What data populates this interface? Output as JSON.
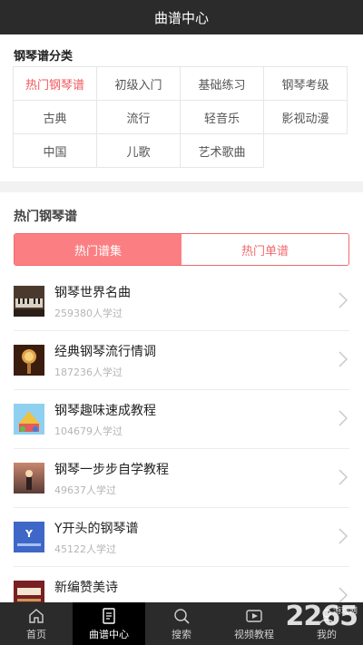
{
  "header": {
    "title": "曲谱中心"
  },
  "categories": {
    "title": "钢琴谱分类",
    "items": [
      {
        "label": "热门钢琴谱",
        "active": true
      },
      {
        "label": "初级入门"
      },
      {
        "label": "基础练习"
      },
      {
        "label": "钢琴考级"
      },
      {
        "label": "古典"
      },
      {
        "label": "流行"
      },
      {
        "label": "轻音乐"
      },
      {
        "label": "影视动漫"
      },
      {
        "label": "中国"
      },
      {
        "label": "儿歌"
      },
      {
        "label": "艺术歌曲"
      }
    ]
  },
  "hot": {
    "title": "热门钢琴谱",
    "tabs": [
      {
        "label": "热门谱集",
        "active": true
      },
      {
        "label": "热门单谱"
      }
    ],
    "items": [
      {
        "title": "钢琴世界名曲",
        "sub": "259380人学过"
      },
      {
        "title": "经典钢琴流行情调",
        "sub": "187236人学过"
      },
      {
        "title": "钢琴趣味速成教程",
        "sub": "104679人学过"
      },
      {
        "title": "钢琴一步步自学教程",
        "sub": "49637人学过"
      },
      {
        "title": "Y开头的钢琴谱",
        "sub": "45122人学过"
      },
      {
        "title": "新编赞美诗",
        "sub": ""
      }
    ]
  },
  "tabbar": {
    "items": [
      {
        "label": "首页",
        "icon": "home-icon"
      },
      {
        "label": "曲谱中心",
        "icon": "score-icon",
        "active": true
      },
      {
        "label": "搜索",
        "icon": "search-icon"
      },
      {
        "label": "视频教程",
        "icon": "video-icon"
      },
      {
        "label": "我的",
        "icon": "user-icon"
      }
    ]
  },
  "watermark": {
    "text": "2265",
    "sub": "游戏网"
  },
  "colors": {
    "accent": "#f06a6e",
    "header_bg": "#2b2b2b",
    "active_tab_bg": "#000000"
  }
}
